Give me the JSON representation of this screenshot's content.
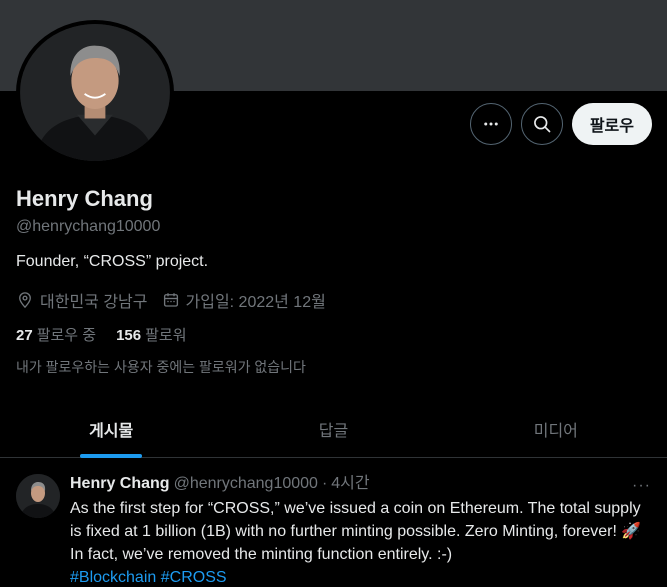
{
  "profile": {
    "name": "Henry Chang",
    "handle": "@henrychang10000",
    "bio": "Founder, “CROSS” project.",
    "location": "대한민국 강남구",
    "joined": "가입일: 2022년 12월",
    "following_count": "27",
    "following_label": "팔로우 중",
    "followers_count": "156",
    "followers_label": "팔로워",
    "no_mutual": "내가 팔로우하는 사용자 중에는 팔로워가 없습니다"
  },
  "actions": {
    "more_icon": "more-icon",
    "search_icon": "search-icon",
    "follow_label": "팔로우"
  },
  "tabs": [
    {
      "label": "게시물",
      "active": true
    },
    {
      "label": "답글",
      "active": false
    },
    {
      "label": "미디어",
      "active": false
    }
  ],
  "tweet": {
    "name": "Henry Chang",
    "handle": "@henrychang10000",
    "dot": "·",
    "time": "4시간",
    "more": "···",
    "text": "As the first step for “CROSS,” we’ve issued a coin on Ethereum. The total supply is fixed at 1 billion (1B) with no further minting possible. Zero Minting, forever! 🚀 In fact, we’ve removed the minting function entirely. :-)",
    "hashtags": [
      "#Blockchain",
      "#CROSS"
    ]
  },
  "colors": {
    "accent": "#1d9bf0",
    "background": "#000000",
    "banner": "#323538",
    "muted_text": "#71767b"
  }
}
